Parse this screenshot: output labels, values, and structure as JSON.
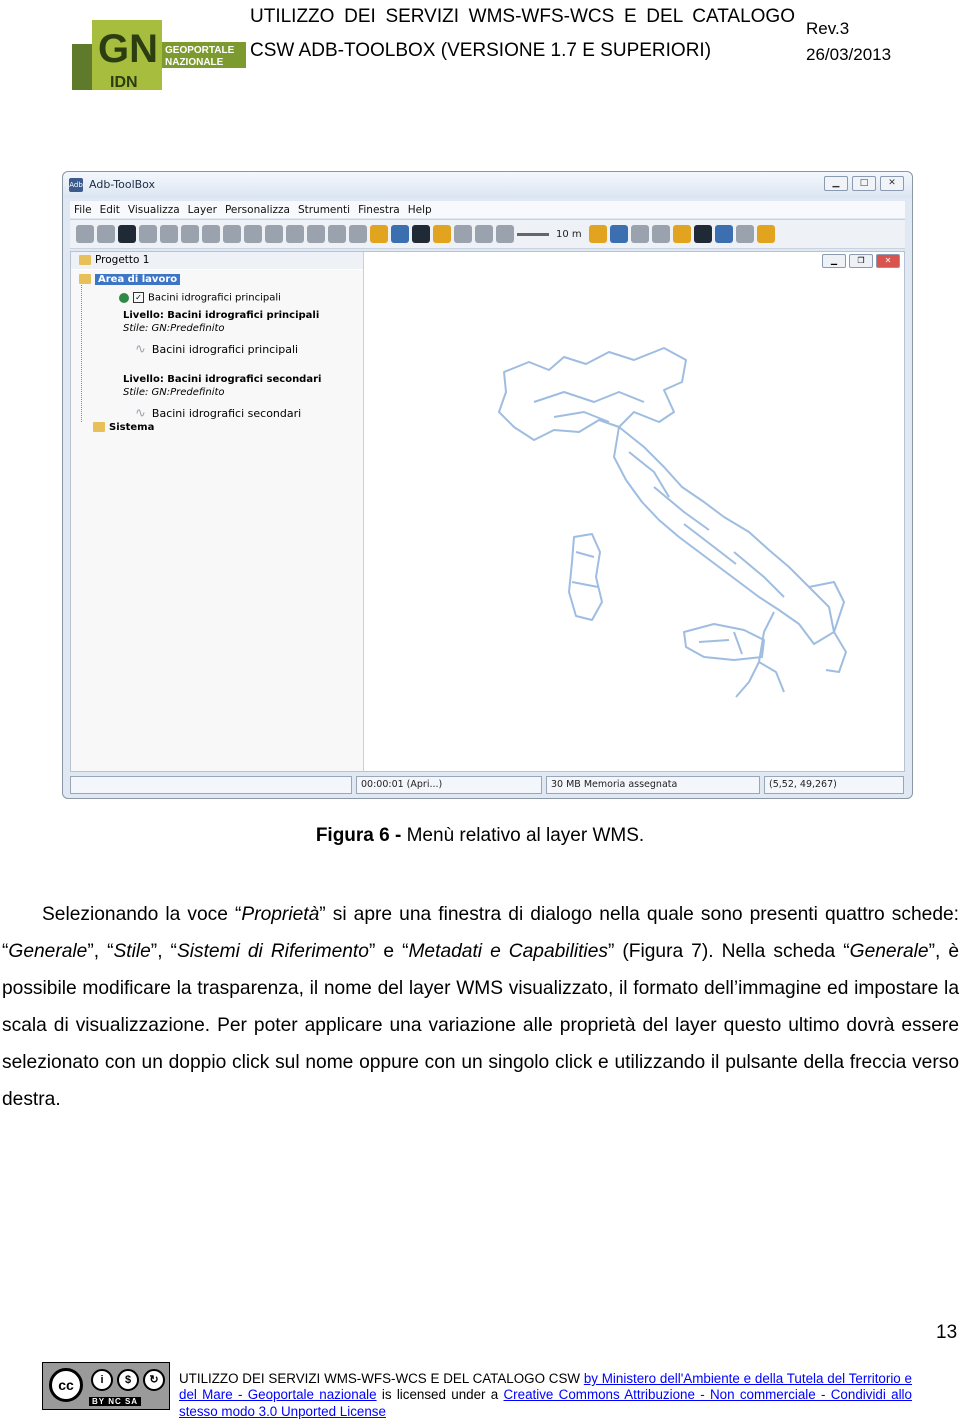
{
  "header": {
    "logo_text": "GN IDN GEOPORTALE NAZIONALE",
    "title": "UTILIZZO DEI SERVIZI WMS-WFS-WCS E DEL CATALOGO CSW ADB-TOOLBOX (VERSIONE 1.7 E SUPERIORI)",
    "revision": "Rev.3",
    "date": "26/03/2013"
  },
  "screenshot": {
    "window_title": "Adb-ToolBox",
    "menu": [
      "File",
      "Edit",
      "Visualizza",
      "Layer",
      "Personalizza",
      "Strumenti",
      "Finestra",
      "Help"
    ],
    "scale": "10 m",
    "tree": {
      "project": "Progetto 1",
      "workspace": "Area di lavoro",
      "layer1_checkbox": "Bacini idrografici principali",
      "layer1_level": "Livello: Bacini idrografici principali",
      "layer1_style": "Stile: GN:Predefinito",
      "layer1_legend": "Bacini idrografici principali",
      "layer2_level": "Livello: Bacini idrografici secondari",
      "layer2_style": "Stile: GN:Predefinito",
      "layer2_legend": "Bacini idrografici secondari",
      "system": "Sistema"
    },
    "status": {
      "time": "00:00:01 (Apri...)",
      "memory": "30 MB Memoria assegnata",
      "coords": "(5,52, 49,267)"
    }
  },
  "caption": {
    "label": "Figura 6 -",
    "text": " Menù relativo al layer WMS."
  },
  "body": {
    "s1": "Selezionando la voce ",
    "i1": "Proprietà",
    "s2": " si apre una finestra di dialogo nella quale sono presenti quattro schede: ",
    "i2": "Generale",
    "s3": ", ",
    "i3": "Stile",
    "s4": ", ",
    "i4": "Sistemi di Riferimento",
    "s5": " e ",
    "i5": "Metadati e Capabilities",
    "s6": " (Figura 7). Nella scheda ",
    "i6": "Generale",
    "s7": ", è possibile modificare la trasparenza, il nome del layer WMS visualizzato, il formato dell’immagine ed impostare la scala di visualizzazione. Per poter applicare una variazione alle proprietà del layer questo ultimo dovrà essere selezionato con un doppio click sul nome oppure con un singolo click e utilizzando il pulsante della freccia verso destra."
  },
  "page_number": "13",
  "footer": {
    "cc_label": "BY NC SA",
    "t1": "UTILIZZO DEI SERVIZI WMS-WFS-WCS E DEL CATALOGO CSW ",
    "link1": "by Ministero dell'Ambiente e della Tutela del Territorio e del Mare - Geoportale nazionale",
    "t2": " is licensed under a ",
    "link2": "Creative Commons Attribuzione - Non commerciale - Condividi allo stesso modo 3.0 Unported License"
  }
}
